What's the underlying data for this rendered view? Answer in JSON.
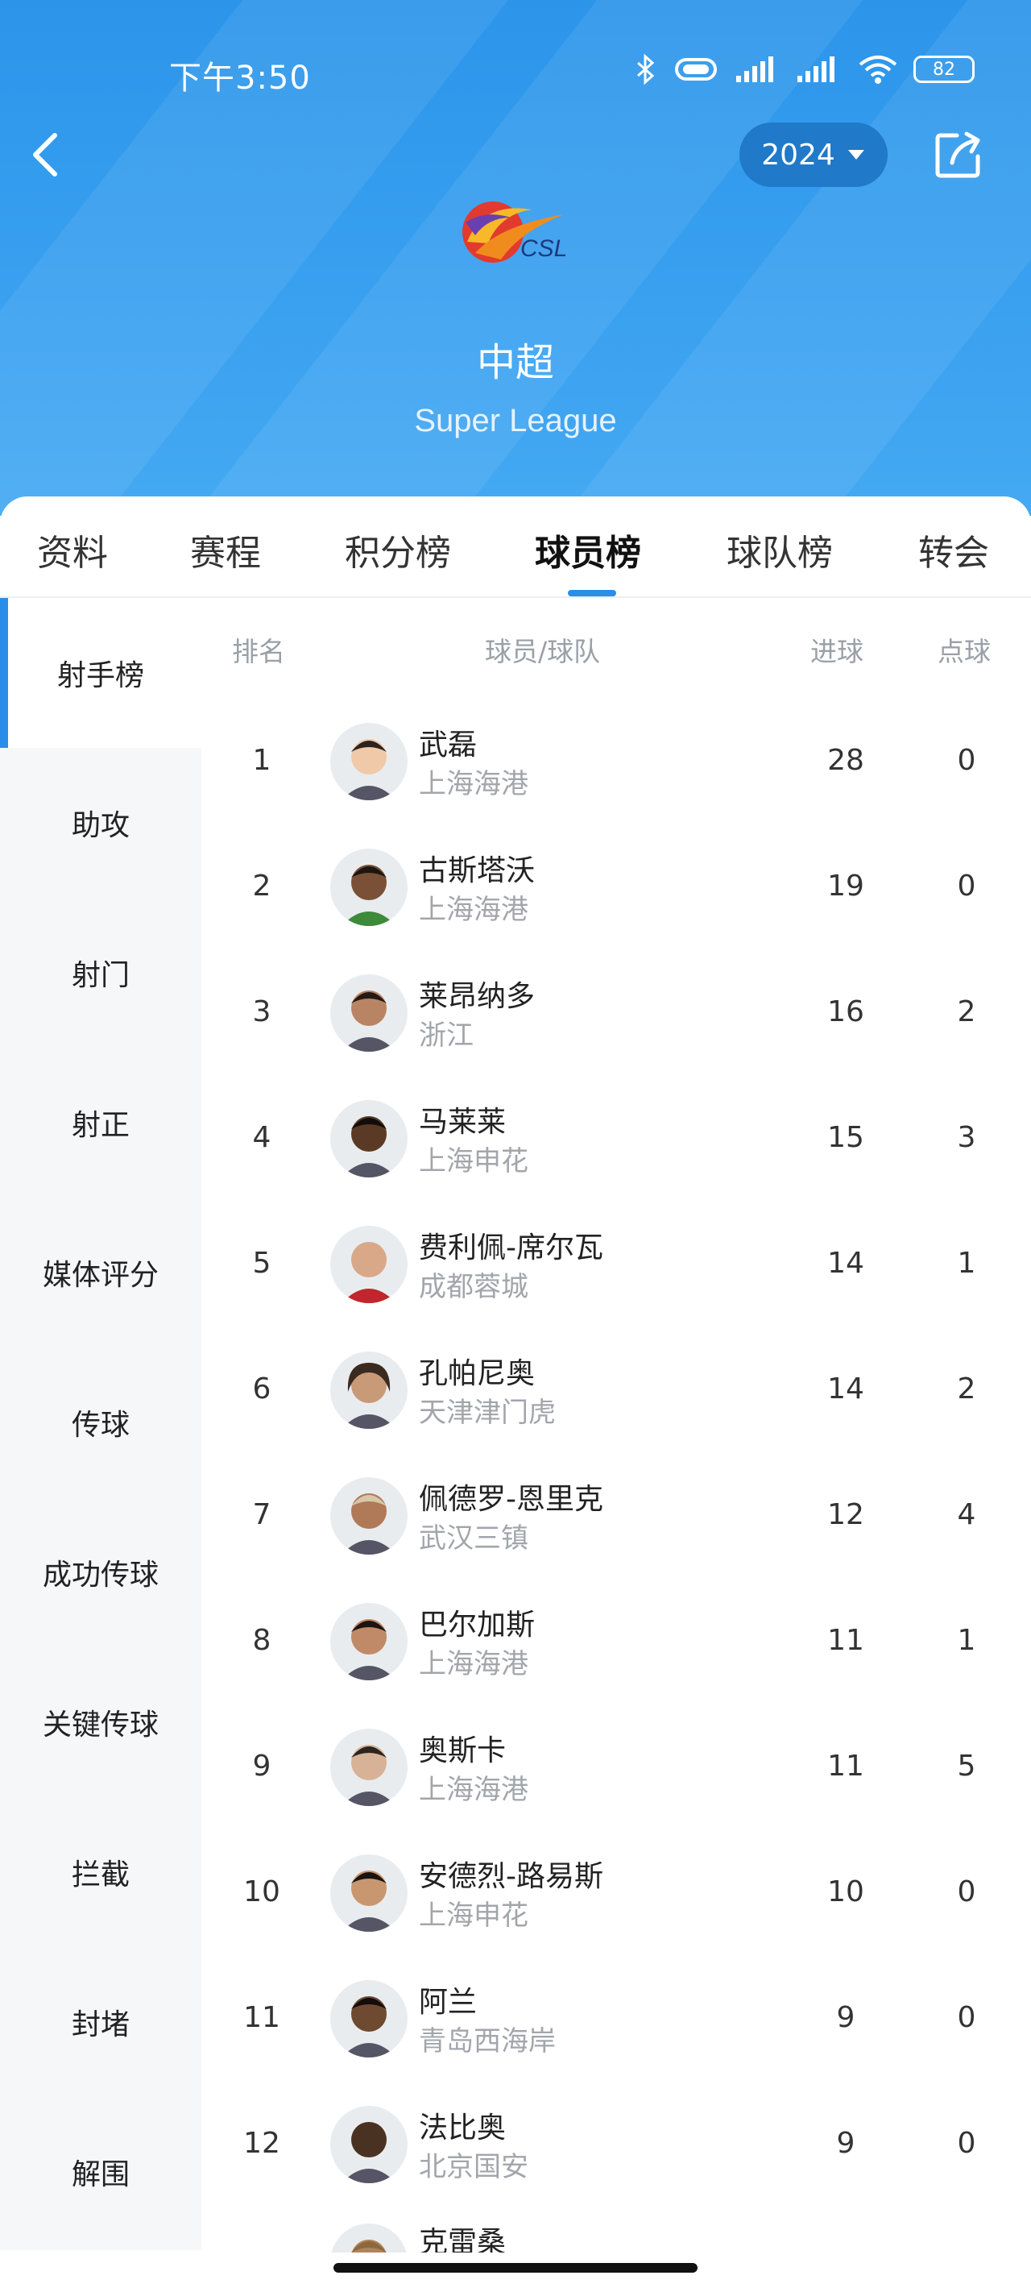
{
  "status_bar": {
    "time": "下午3:50",
    "battery": "82"
  },
  "header": {
    "year": "2024",
    "logo_text": "CSL",
    "league_name_cn": "中超",
    "league_name_en": "Super League"
  },
  "tabs": [
    "资料",
    "赛程",
    "积分榜",
    "球员榜",
    "球队榜",
    "转会"
  ],
  "active_tab": "球员榜",
  "sidebar": [
    "射手榜",
    "助攻",
    "射门",
    "射正",
    "媒体评分",
    "传球",
    "成功传球",
    "关键传球",
    "拦截",
    "封堵",
    "解围"
  ],
  "active_sidebar": "射手榜",
  "table": {
    "headers": {
      "rank": "排名",
      "player_team": "球员/球队",
      "goals": "进球",
      "penalties": "点球"
    },
    "rows": [
      {
        "rank": "1",
        "name": "武磊",
        "team": "上海海港",
        "goals": "28",
        "penalties": "0"
      },
      {
        "rank": "2",
        "name": "古斯塔沃",
        "team": "上海海港",
        "goals": "19",
        "penalties": "0"
      },
      {
        "rank": "3",
        "name": "莱昂纳多",
        "team": "浙江",
        "goals": "16",
        "penalties": "2"
      },
      {
        "rank": "4",
        "name": "马莱莱",
        "team": "上海申花",
        "goals": "15",
        "penalties": "3"
      },
      {
        "rank": "5",
        "name": "费利佩-席尔瓦",
        "team": "成都蓉城",
        "goals": "14",
        "penalties": "1"
      },
      {
        "rank": "6",
        "name": "孔帕尼奥",
        "team": "天津津门虎",
        "goals": "14",
        "penalties": "2"
      },
      {
        "rank": "7",
        "name": "佩德罗-恩里克",
        "team": "武汉三镇",
        "goals": "12",
        "penalties": "4"
      },
      {
        "rank": "8",
        "name": "巴尔加斯",
        "team": "上海海港",
        "goals": "11",
        "penalties": "1"
      },
      {
        "rank": "9",
        "name": "奥斯卡",
        "team": "上海海港",
        "goals": "11",
        "penalties": "5"
      },
      {
        "rank": "10",
        "name": "安德烈-路易斯",
        "team": "上海申花",
        "goals": "10",
        "penalties": "0"
      },
      {
        "rank": "11",
        "name": "阿兰",
        "team": "青岛西海岸",
        "goals": "9",
        "penalties": "0"
      },
      {
        "rank": "12",
        "name": "法比奥",
        "team": "北京国安",
        "goals": "9",
        "penalties": "0"
      },
      {
        "rank": "",
        "name": "克雷桑",
        "team": "",
        "goals": "",
        "penalties": ""
      }
    ]
  },
  "avatar_skin_colors": [
    "#f0c9a8",
    "#7a5136",
    "#b98463",
    "#5b3a25",
    "#d9a889",
    "#c99a78",
    "#b07a58",
    "#c08a68",
    "#d8b296",
    "#c9976f",
    "#6e4a31",
    "#4a3222",
    "#b0835e"
  ],
  "colors": {
    "header_blue": "#3aa1f0",
    "accent": "#2a8ee8",
    "year_pill": "#2079c9",
    "sidebar_bg": "#f6f7f9"
  }
}
